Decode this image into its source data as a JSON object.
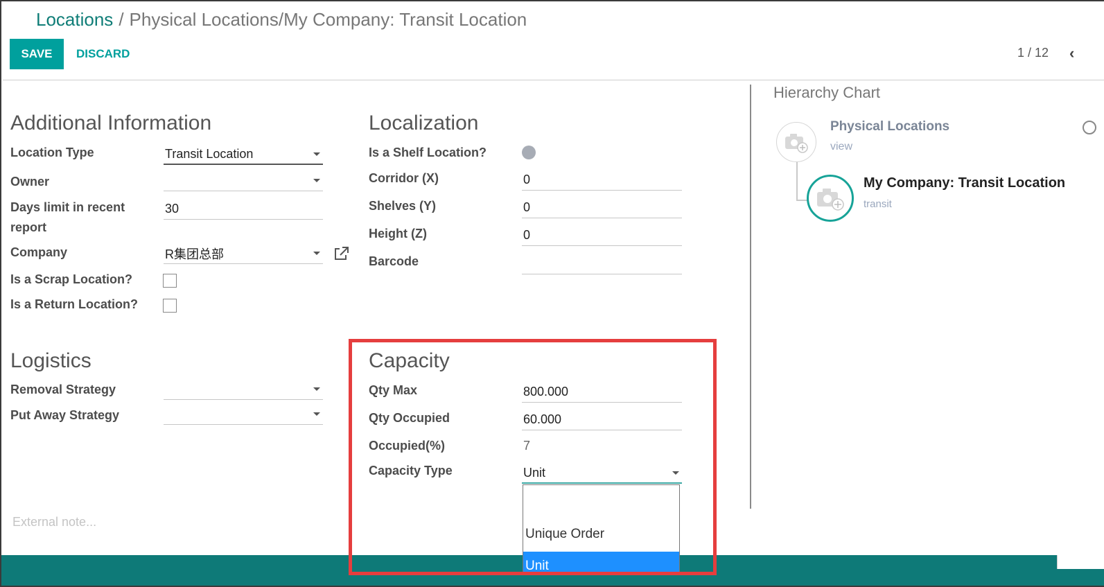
{
  "breadcrumb": {
    "parent": "Locations",
    "separator": "/",
    "current": "Physical Locations/My Company: Transit Location"
  },
  "toolbar": {
    "save_label": "SAVE",
    "discard_label": "DISCARD",
    "pager": "1 / 12",
    "prev_icon": "‹"
  },
  "additional_info": {
    "title": "Additional Information",
    "location_type_label": "Location Type",
    "location_type_value": "Transit Location",
    "owner_label": "Owner",
    "owner_value": "",
    "days_limit_label_1": "Days limit in recent",
    "days_limit_label_2": "report",
    "days_limit_value": "30",
    "company_label": "Company",
    "company_value": "R集团总部",
    "scrap_label": "Is a Scrap Location?",
    "return_label": "Is a Return Location?"
  },
  "localization": {
    "title": "Localization",
    "shelf_label": "Is a Shelf Location?",
    "corridor_label": "Corridor (X)",
    "corridor_value": "0",
    "shelves_label": "Shelves (Y)",
    "shelves_value": "0",
    "height_label": "Height (Z)",
    "height_value": "0",
    "barcode_label": "Barcode",
    "barcode_value": ""
  },
  "logistics": {
    "title": "Logistics",
    "removal_label": "Removal Strategy",
    "putaway_label": "Put Away Strategy"
  },
  "capacity": {
    "title": "Capacity",
    "qty_max_label": "Qty Max",
    "qty_max_value": "800.000",
    "qty_occupied_label": "Qty Occupied",
    "qty_occupied_value": "60.000",
    "occupied_pct_label": "Occupied(%)",
    "occupied_pct_value": "7",
    "capacity_type_label": "Capacity Type",
    "capacity_type_value": "Unit",
    "options": [
      "",
      "Unique Order",
      "Unit"
    ]
  },
  "external_note_placeholder": "External note...",
  "hierarchy": {
    "title": "Hierarchy Chart",
    "parent_name": "Physical Locations",
    "parent_type": "view",
    "child_name": "My Company: Transit Location",
    "child_type": "transit"
  },
  "colors": {
    "accent": "#00a09d",
    "breadcrumb_link": "#0f7d77",
    "highlight": "#e53e3e",
    "selected_option": "#1e90ff",
    "bottom_bar": "#0e7a78"
  }
}
